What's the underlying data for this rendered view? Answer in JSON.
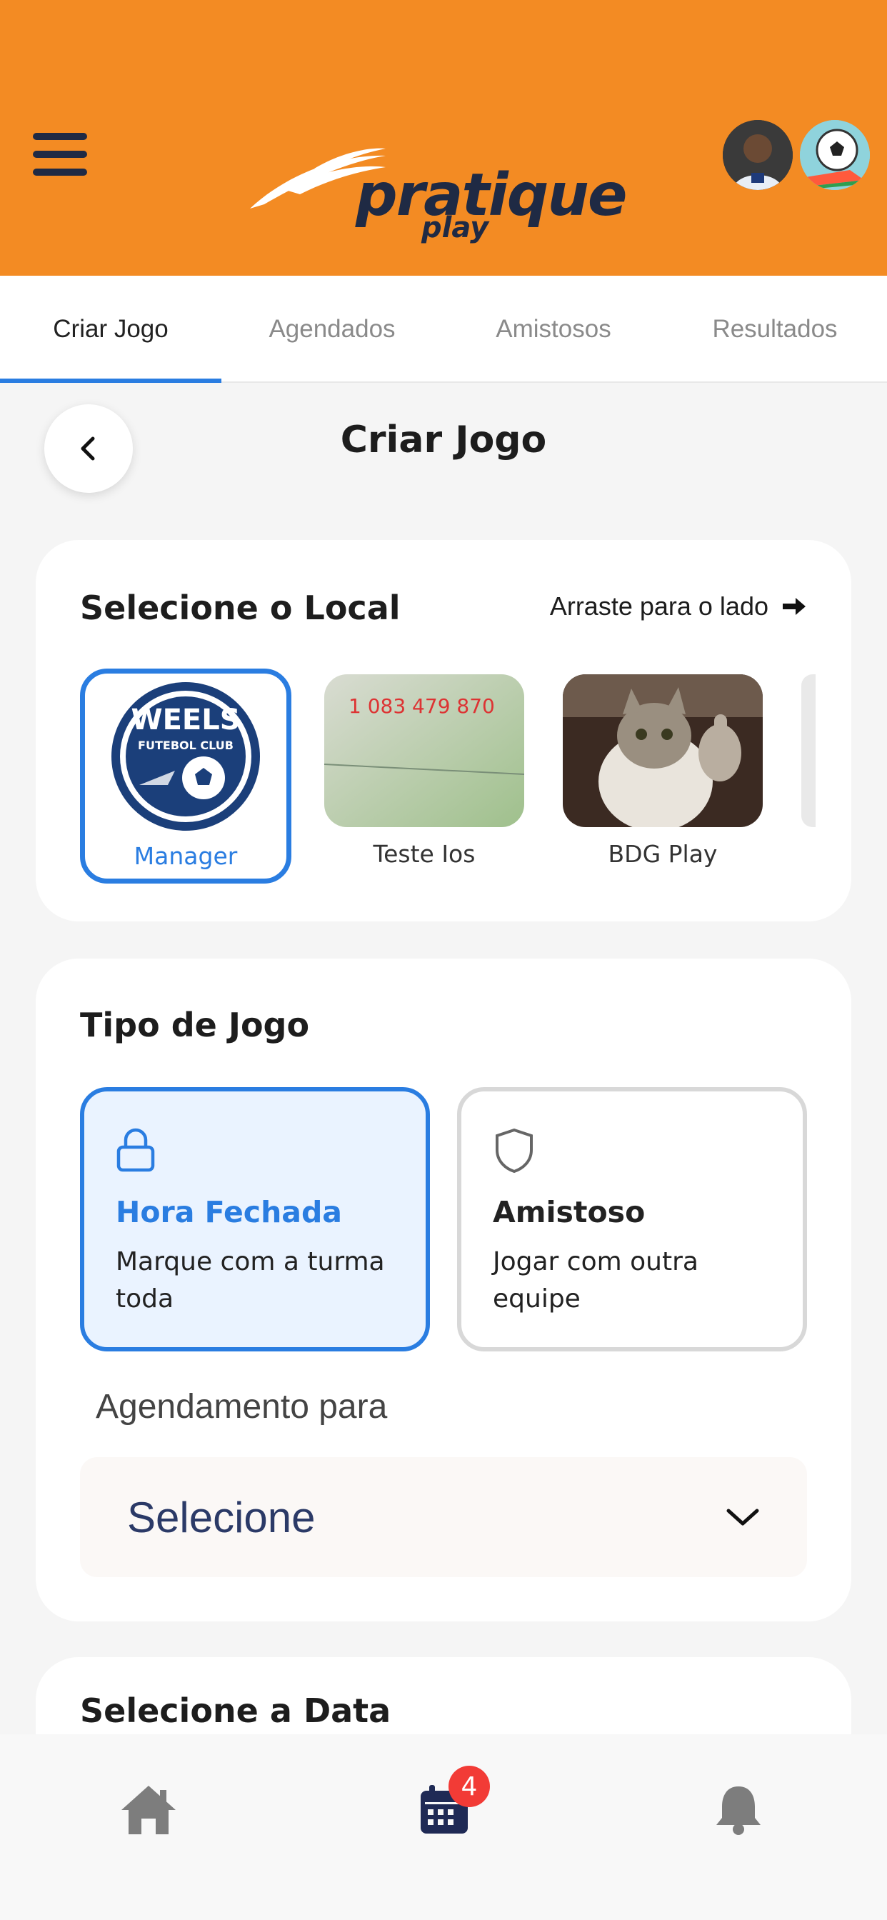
{
  "header": {
    "logo_text": "pratique",
    "logo_sub": "play",
    "menu_icon": "hamburger-icon"
  },
  "tabs": [
    {
      "label": "Criar Jogo",
      "active": true
    },
    {
      "label": "Agendados",
      "active": false
    },
    {
      "label": "Amistosos",
      "active": false
    },
    {
      "label": "Resultados",
      "active": false
    }
  ],
  "page": {
    "title": "Criar Jogo",
    "back_icon": "chevron-left-icon"
  },
  "local": {
    "title": "Selecione o Local",
    "swipe_hint": "Arraste para o lado",
    "swipe_icon": "arrow-right-icon",
    "venues": [
      {
        "label": "Manager",
        "selected": true,
        "logo_arc_top": "WEELS",
        "logo_ring": "FUTEBOL CLUB"
      },
      {
        "label": "Teste Ios",
        "selected": false,
        "image_text": "1 083 479 870"
      },
      {
        "label": "BDG Play",
        "selected": false
      }
    ]
  },
  "tipo": {
    "title": "Tipo de Jogo",
    "options": [
      {
        "title": "Hora Fechada",
        "desc": "Marque com a turma toda",
        "icon": "lock-icon",
        "selected": true
      },
      {
        "title": "Amistoso",
        "desc": "Jogar com outra equipe",
        "icon": "shield-icon",
        "selected": false
      }
    ],
    "schedule_label": "Agendamento para",
    "select_value": "Selecione",
    "select_icon": "chevron-down-icon"
  },
  "data_section": {
    "title": "Selecione a Data"
  },
  "bottom_nav": {
    "items": [
      {
        "icon": "home-icon"
      },
      {
        "icon": "calendar-icon",
        "badge": "4"
      },
      {
        "icon": "bell-icon"
      }
    ]
  },
  "colors": {
    "brand_orange": "#f38b23",
    "accent_blue": "#2a7de1",
    "navy": "#1f2a44",
    "badge_red": "#f23b36"
  }
}
